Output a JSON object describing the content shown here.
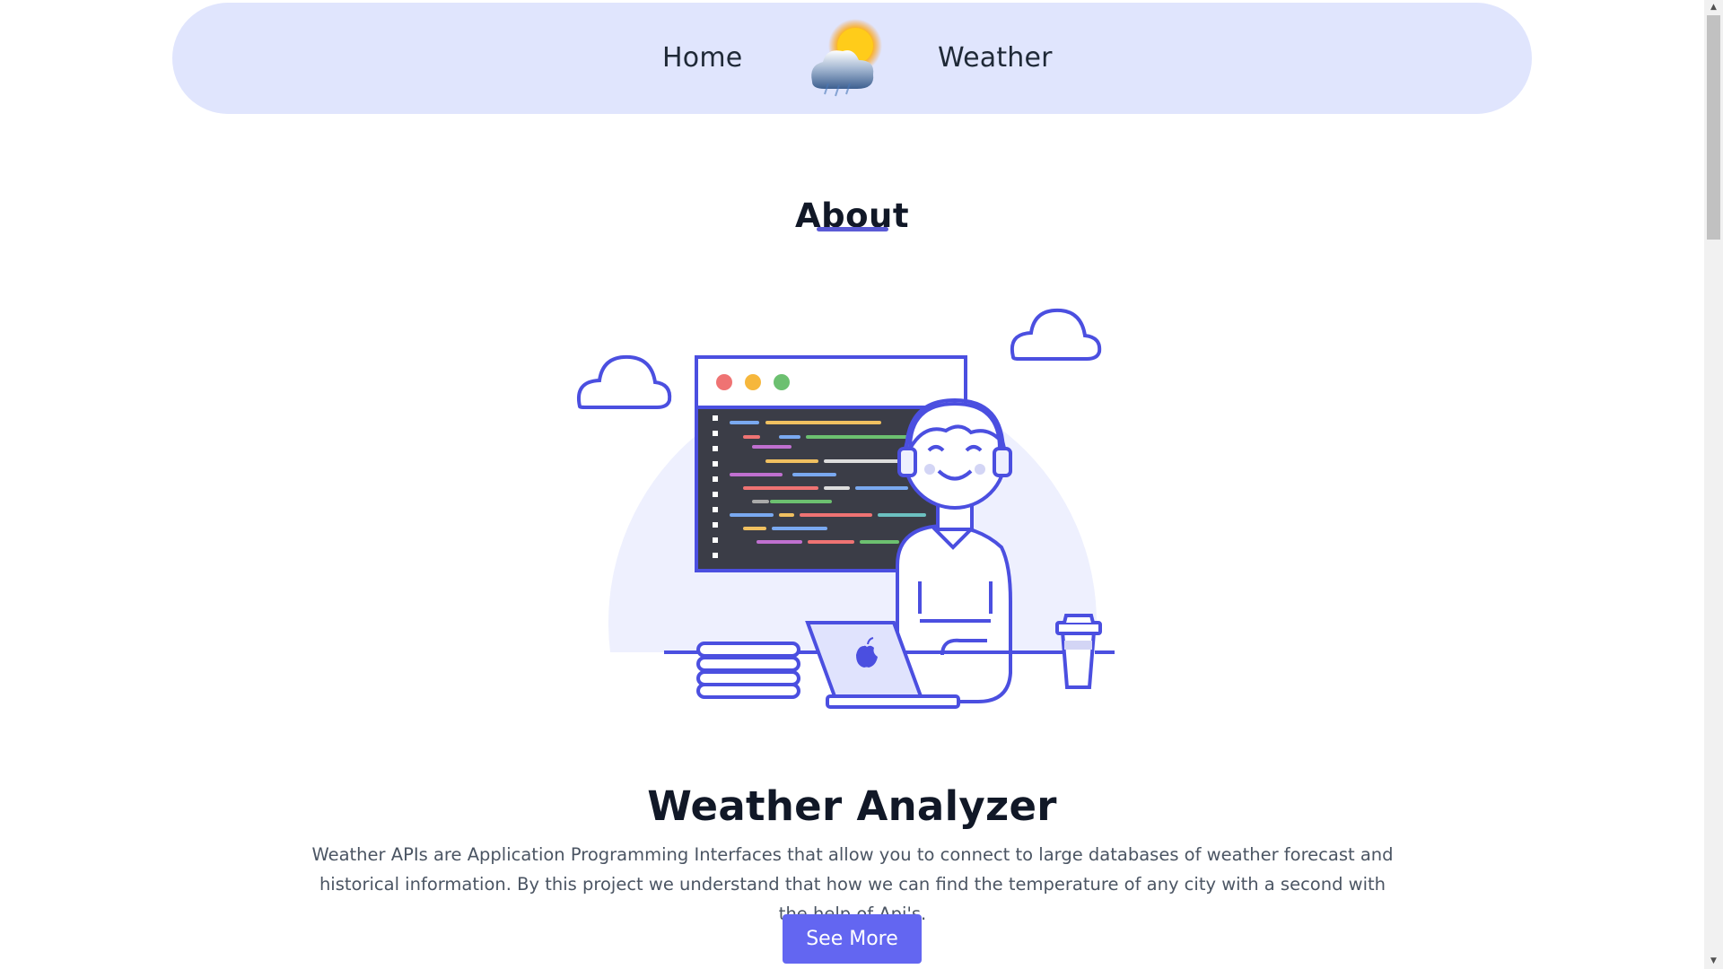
{
  "nav": {
    "home_label": "Home",
    "weather_label": "Weather",
    "logo_icon": "sun-cloud-icon"
  },
  "about": {
    "heading": "About"
  },
  "project": {
    "title": "Weather Analyzer",
    "description": "Weather APIs are Application Programming Interfaces that allow you to connect to large databases of weather forecast and historical information. By this project we understand that how we can find the temperature of any city with a second with the help of Api's.",
    "button_label": "See More"
  },
  "colors": {
    "navbar_bg": "#e0e5fd",
    "accent": "#6366f1",
    "illustration_stroke": "#4b4fe0",
    "illustration_circle": "#eef0fe"
  },
  "icons": [
    "sun-cloud-icon",
    "cloud-icon",
    "code-window-icon",
    "developer-with-headphones-illustration",
    "laptop-icon",
    "coffee-cup-icon",
    "books-stack-icon"
  ]
}
